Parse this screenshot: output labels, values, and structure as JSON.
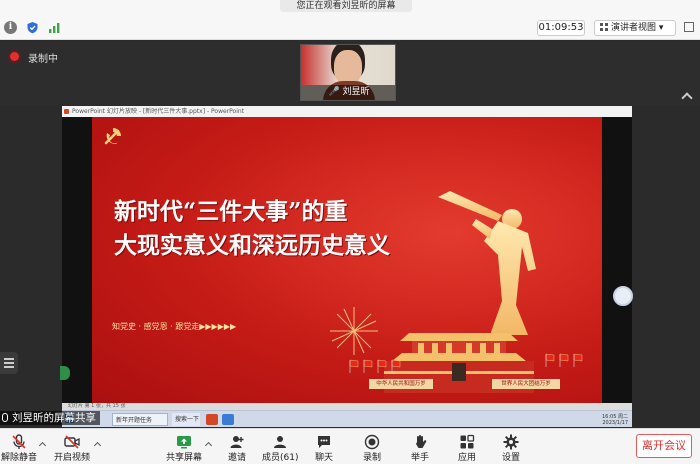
{
  "window": {
    "share_notice": "您正在观看刘昱昕的屏幕"
  },
  "header": {
    "timer": "01:09:53",
    "view_mode": "演讲者视图"
  },
  "recording": {
    "status": "录制中"
  },
  "participant": {
    "name": "刘昱昕"
  },
  "shared_screen": {
    "ppt_title": "PowerPoint 幻灯片放映 - [新时代三件大事.pptx] - PowerPoint",
    "headline_line1": "新时代“三件大事”的重",
    "headline_line2": "大现实意义和深远历史意义",
    "subtitle": "知党史 · 感党恩 · 跟党走▶▶▶▶▶▶",
    "banner_left": "中华人民共和国万岁",
    "banner_right": "世界人民大团结万岁",
    "slide_status": "幻灯片 第 1 张，共 15 张",
    "taskbar_task1": "新年开题任务",
    "taskbar_task2": "搜索一下",
    "clock_time": "16:05 周二",
    "clock_date": "2023/1/17"
  },
  "share_label": "刘昱昕的屏幕共享",
  "toolbar": {
    "mute": "解除静音",
    "video": "开启视频",
    "share": "共享屏幕",
    "invite": "邀请",
    "members": "成员(61)",
    "chat": "聊天",
    "record": "录制",
    "raise_hand": "举手",
    "apps": "应用",
    "settings": "设置",
    "leave": "离开会议"
  },
  "colors": {
    "slide_red": "#c51b16",
    "leave_red": "#d93030",
    "record_dot": "#e03030"
  }
}
